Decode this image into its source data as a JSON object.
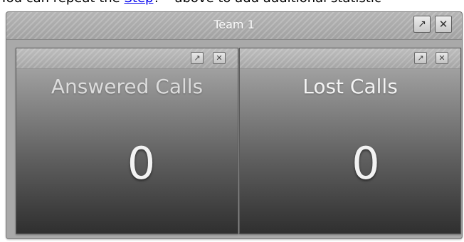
{
  "doc": {
    "prefix": "You can repeat the ",
    "link": "Step",
    "suffix": "? * above to add additional statistic"
  },
  "team_window": {
    "title": "Team 1",
    "popout_icon": "popout-icon",
    "close_icon": "close-icon"
  },
  "widgets": [
    {
      "title": "Answered Calls",
      "value": "0"
    },
    {
      "title": "Lost Calls",
      "value": "0"
    }
  ],
  "icons": {
    "popout": "↗",
    "close": "✕"
  },
  "colors": {
    "link": "#0000ee",
    "window_bg": "#a9a9a9",
    "widget_top": "#b0b0b0",
    "widget_bottom": "#2f2f2f"
  }
}
